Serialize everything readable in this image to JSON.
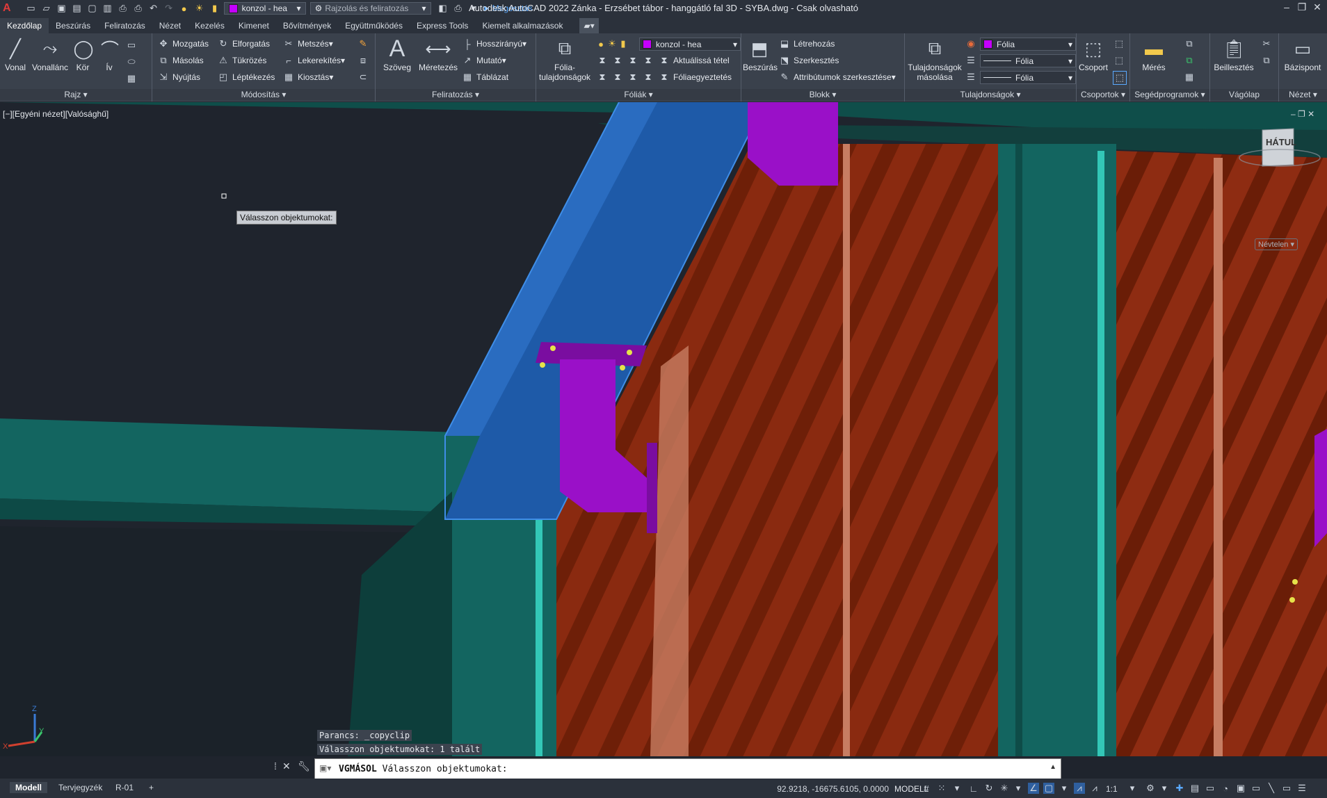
{
  "app": {
    "title": "Autodesk AutoCAD 2022   Zánka - Erzsébet tábor - hanggátló fal 3D - SYBA.dwg - Csak olvasható",
    "logo": "A"
  },
  "quick_access": {
    "layer_combo": "konzol - hea",
    "workspace_combo": "Rajzolás és feliratozás",
    "share_label": "Megosztás"
  },
  "tabs": [
    "Kezdőlap",
    "Beszúrás",
    "Feliratozás",
    "Nézet",
    "Kezelés",
    "Kimenet",
    "Bővítmények",
    "Együttműködés",
    "Express Tools",
    "Kiemelt alkalmazások"
  ],
  "ribbon": {
    "draw": {
      "title": "Rajz",
      "line": "Vonal",
      "polyline": "Vonallánc",
      "circle": "Kör",
      "arc": "Ív"
    },
    "modify": {
      "title": "Módosítás",
      "move": "Mozgatás",
      "rotate": "Elforgatás",
      "trim": "Metszés",
      "copy": "Másolás",
      "mirror": "Tükrözés",
      "fillet": "Lekerekítés",
      "stretch": "Nyújtás",
      "scale": "Léptékezés",
      "array": "Kiosztás"
    },
    "annotation": {
      "title": "Feliratozás",
      "text": "Szöveg",
      "dimension": "Méretezés",
      "linear": "Hosszirányú",
      "leader": "Mutató",
      "table": "Táblázat"
    },
    "layers": {
      "title": "Fóliák",
      "properties_line1": "Fólia-",
      "properties_line2": "tulajdonságok",
      "current_layer": "konzol - hea",
      "make_current": "Aktuálissá tétel",
      "match": "Fóliaegyeztetés"
    },
    "block": {
      "title": "Blokk",
      "insert": "Beszúrás",
      "create": "Létrehozás",
      "edit": "Szerkesztés",
      "edit_attributes": "Attribútumok szerkesztése"
    },
    "properties": {
      "title": "Tulajdonságok",
      "match_line1": "Tulajdonságok",
      "match_line2": "másolása",
      "color": "Fólia",
      "linetype": "Fólia",
      "lineweight": "Fólia"
    },
    "groups": {
      "title": "Csoportok",
      "group": "Csoport"
    },
    "utilities": {
      "title": "Segédprogramok",
      "measure": "Mérés"
    },
    "clipboard": {
      "title": "Vágólap",
      "paste": "Beillesztés"
    },
    "view": {
      "title": "Nézet",
      "base": "Bázispont"
    }
  },
  "viewport": {
    "label": "[−][Egyéni nézet][Valósághű]",
    "tooltip": "Válasszon objektumokat:",
    "viewcube_face": "HÁTUL",
    "named_view": "Névtelen",
    "ucs_x": "X",
    "ucs_y": "Y",
    "ucs_z": "Z"
  },
  "command": {
    "history": [
      "Parancs: _copyclip",
      "Válasszon objektumokat: 1 talált"
    ],
    "current_cmd": "VGMÁSOL",
    "prompt": "Válasszon objektumokat:"
  },
  "statusbar": {
    "layout_tabs": [
      "Modell",
      "Tervjegyzék",
      "R-01"
    ],
    "coordinates": "92.9218, -16675.6105, 0.0000",
    "mode": "MODELL",
    "scale": "1:1"
  },
  "colors": {
    "beam_teal": "#136560",
    "panel_red": "#8a2a10",
    "bracket_purple": "#9a10c8",
    "beam_blue": "#1e5aa8"
  }
}
